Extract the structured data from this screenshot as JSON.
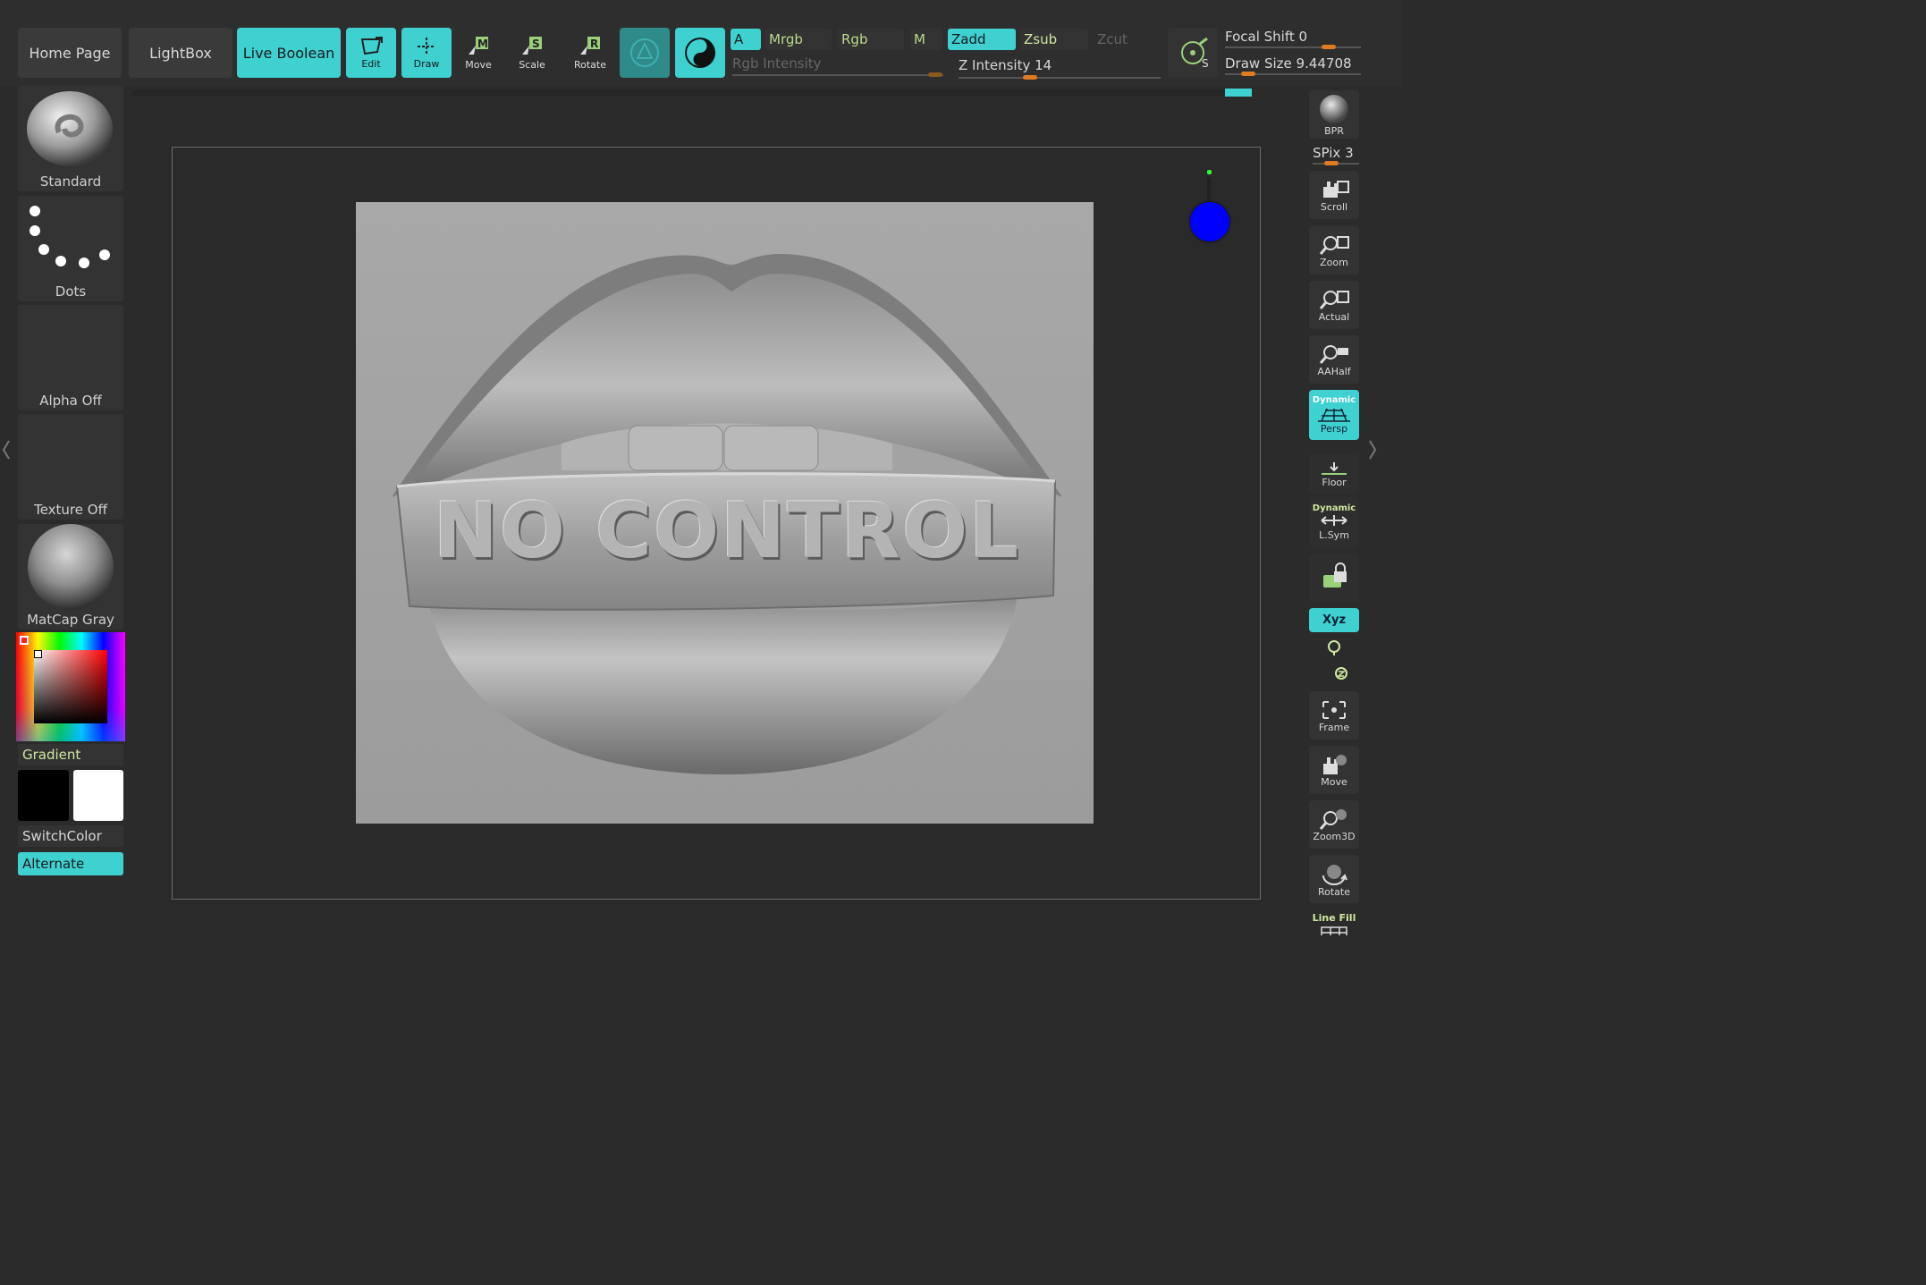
{
  "toolbar": {
    "home_page": "Home Page",
    "lightbox": "LightBox",
    "live_boolean": "Live Boolean",
    "edit": "Edit",
    "draw": "Draw",
    "move": "Move",
    "scale": "Scale",
    "rotate": "Rotate",
    "a": "A",
    "mrgb": "Mrgb",
    "rgb": "Rgb",
    "m": "M",
    "zadd": "Zadd",
    "zsub": "Zsub",
    "zcut": "Zcut",
    "rgb_intensity": "Rgb Intensity",
    "z_intensity_label": "Z Intensity",
    "z_intensity_value": "14",
    "focal_shift_label": "Focal Shift",
    "focal_shift_value": "0",
    "draw_size_label": "Draw Size",
    "draw_size_value": "9.44708"
  },
  "left_shelf": {
    "brush": "Standard",
    "stroke": "Dots",
    "alpha": "Alpha Off",
    "texture": "Texture Off",
    "material": "MatCap Gray",
    "gradient": "Gradient",
    "switch_color": "SwitchColor",
    "alternate": "Alternate"
  },
  "right_shelf": {
    "bpr": "BPR",
    "spix_label": "SPix",
    "spix_value": "3",
    "scroll": "Scroll",
    "zoom": "Zoom",
    "actual": "Actual",
    "aahalf": "AAHalf",
    "dynamic": "Dynamic",
    "persp": "Persp",
    "floor": "Floor",
    "dynamic2": "Dynamic",
    "lsym": "L.Sym",
    "xyz": "Xyz",
    "frame": "Frame",
    "move": "Move",
    "zoom3d": "Zoom3D",
    "rotate": "Rotate",
    "line_fill": "Line Fill"
  },
  "canvas": {
    "sculpt_text": "NO CONTROL"
  },
  "colors": {
    "accent": "#3fd0d0",
    "slider_knob": "#e07b20",
    "gizmo": "#0000ff"
  }
}
